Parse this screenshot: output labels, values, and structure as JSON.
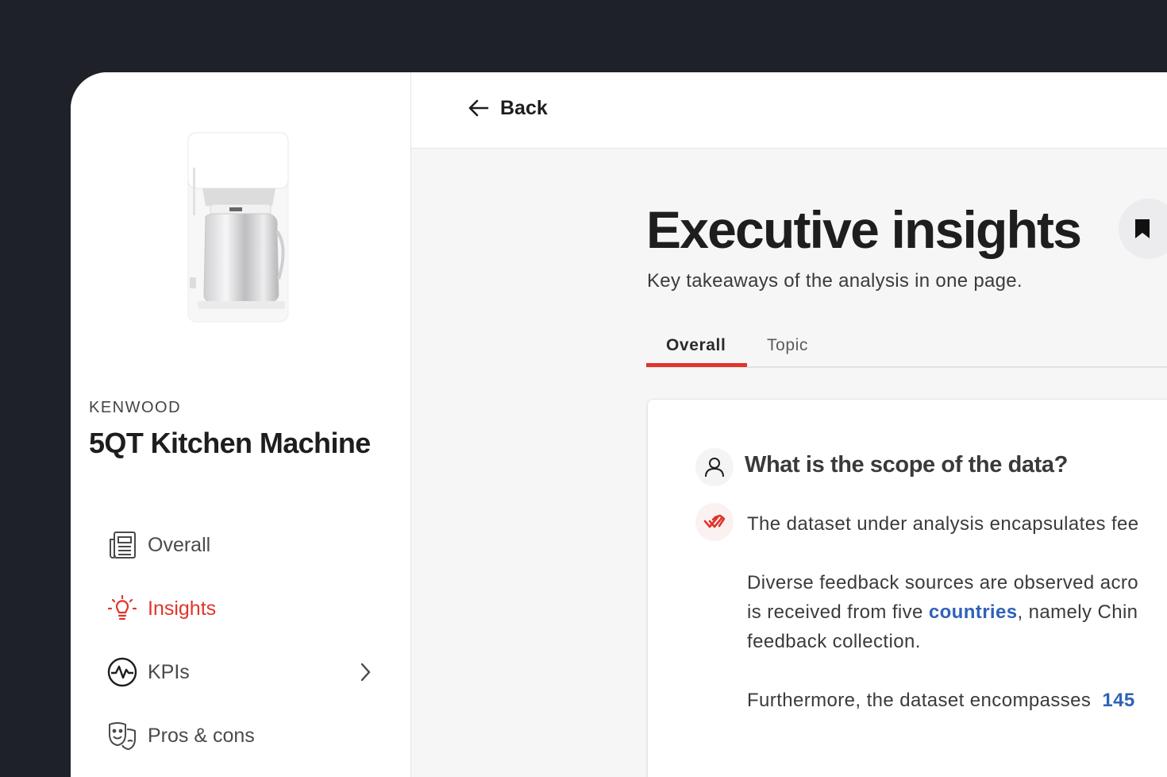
{
  "sidebar": {
    "brand": "KENWOOD",
    "product_name": "5QT Kitchen Machine",
    "items": [
      {
        "label": "Overall",
        "icon": "newspaper-icon",
        "active": false
      },
      {
        "label": "Insights",
        "icon": "lightbulb-icon",
        "active": true
      },
      {
        "label": "KPIs",
        "icon": "pulse-icon",
        "active": false,
        "has_submenu": true
      },
      {
        "label": "Pros & cons",
        "icon": "theater-masks-icon",
        "active": false
      }
    ]
  },
  "topbar": {
    "back_label": "Back"
  },
  "main": {
    "title": "Executive insights",
    "subtitle": "Key takeaways of the analysis in one page.",
    "tabs": [
      {
        "label": "Overall",
        "selected": true
      },
      {
        "label": "Topic",
        "selected": false
      }
    ],
    "card": {
      "question": "What is the scope of the data?",
      "answer": {
        "line1": "The dataset under analysis encapsulates fee",
        "para2_line1": "Diverse feedback sources are observed acro",
        "para2_line2_pre": "is received from five ",
        "para2_line2_highlight": "countries",
        "para2_line2_post": ", namely Chin",
        "para2_line3": "feedback collection.",
        "para3_pre": "Furthermore, the dataset encompasses  ",
        "para3_highlight": "145"
      }
    }
  },
  "colors": {
    "accent": "#e0342c",
    "link": "#2f62b8",
    "background_dark": "#1f2128"
  }
}
